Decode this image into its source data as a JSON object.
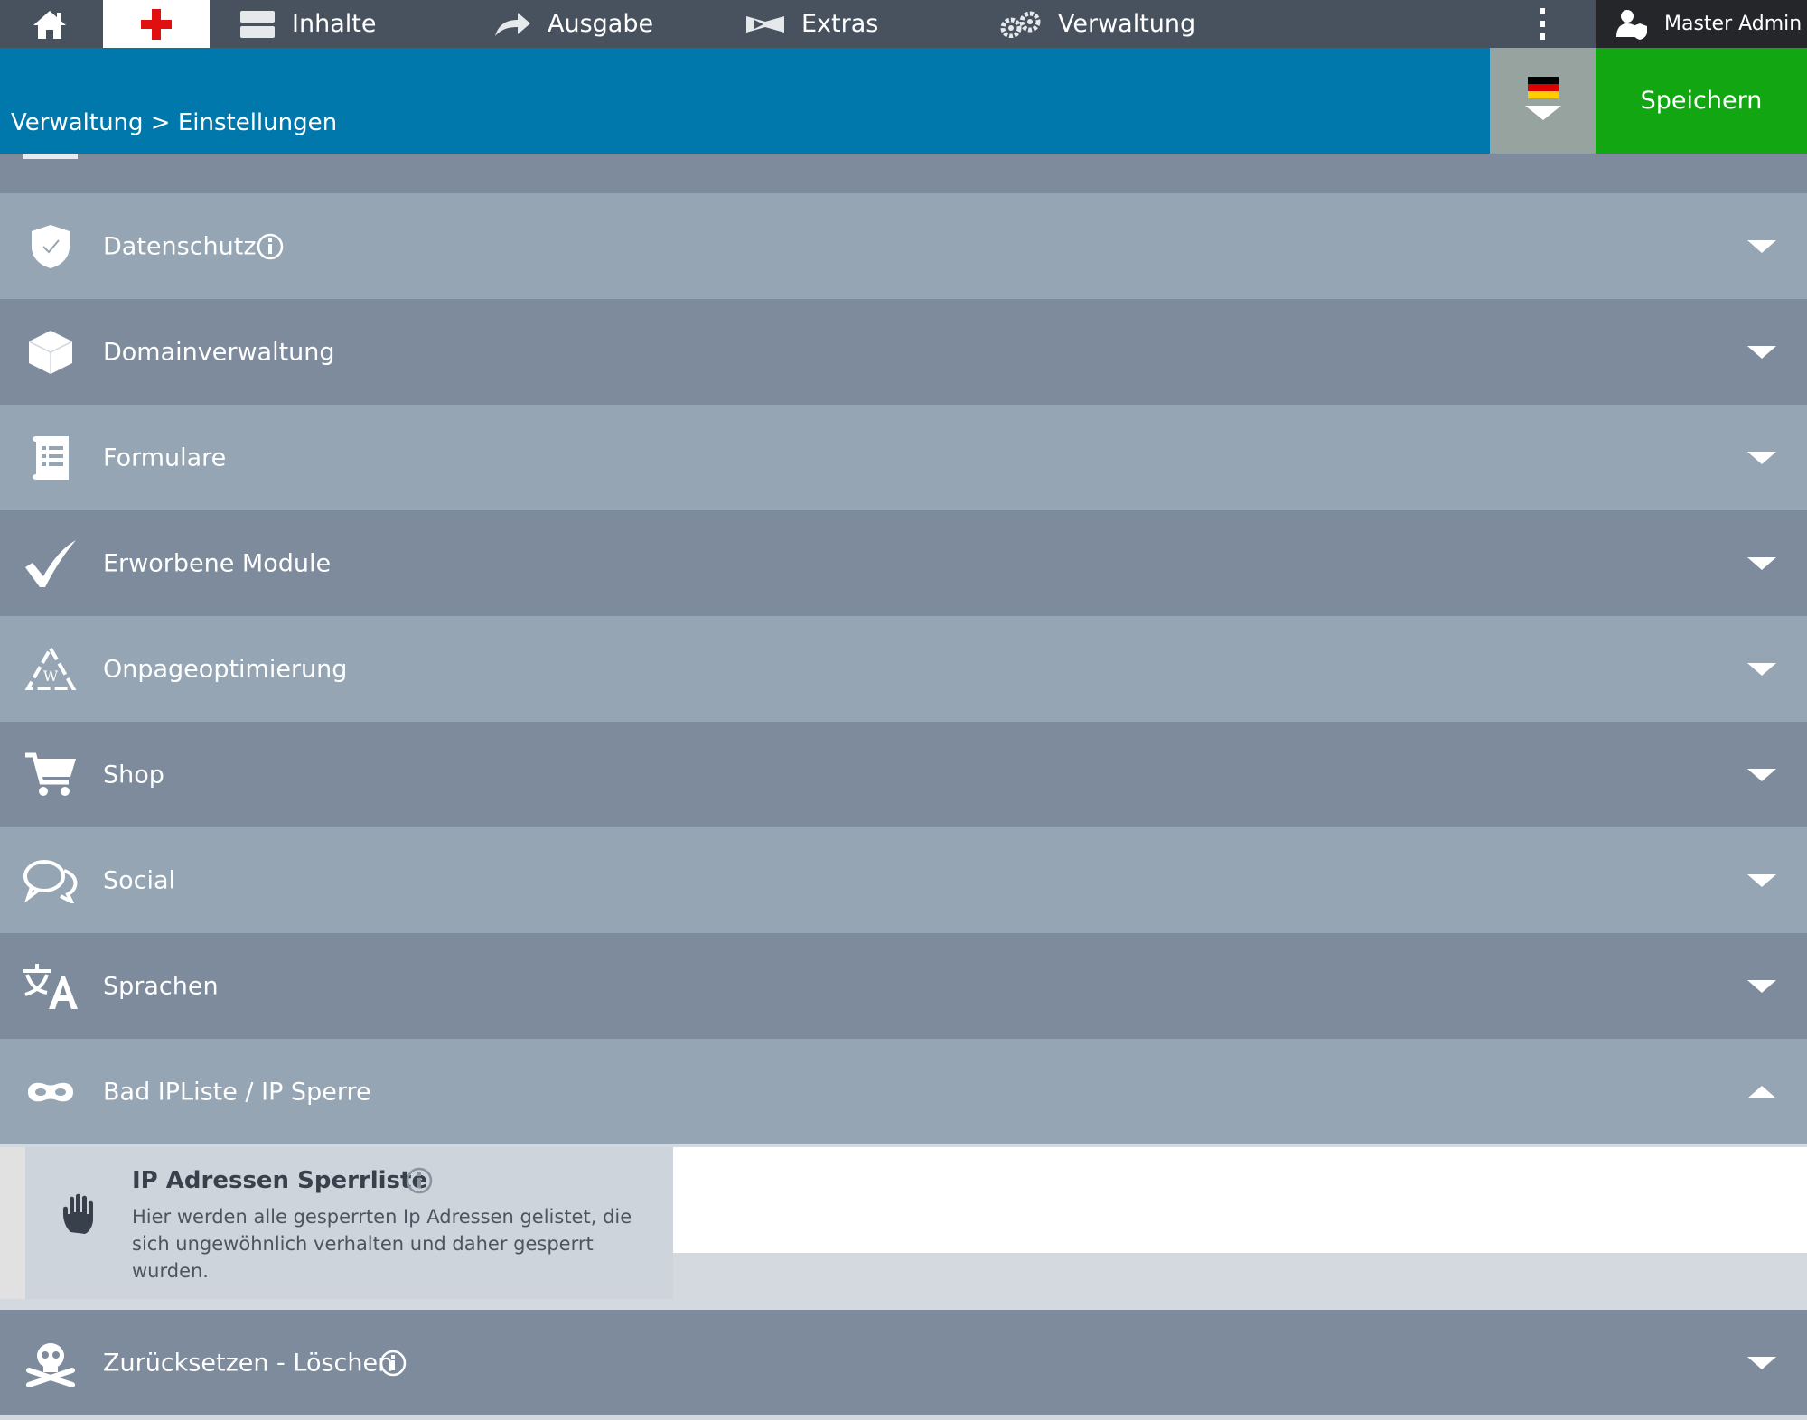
{
  "nav": {
    "items": [
      {
        "label": "Inhalte",
        "icon": "content-icon"
      },
      {
        "label": "Ausgabe",
        "icon": "arrow-right-icon"
      },
      {
        "label": "Extras",
        "icon": "extras-icon"
      },
      {
        "label": "Verwaltung",
        "icon": "gears-icon"
      }
    ],
    "user": "Master Admin"
  },
  "header": {
    "breadcrumb": "Verwaltung > Einstellungen",
    "save_label": "Speichern"
  },
  "sections": [
    {
      "label": "Datenschutz",
      "icon": "shield-check-icon",
      "info": true,
      "expanded": false
    },
    {
      "label": "Domainverwaltung",
      "icon": "cube-icon",
      "info": false,
      "expanded": false
    },
    {
      "label": "Formulare",
      "icon": "form-list-icon",
      "info": false,
      "expanded": false
    },
    {
      "label": "Erworbene Module",
      "icon": "checkmark-icon",
      "info": false,
      "expanded": false
    },
    {
      "label": "Onpageoptimierung",
      "icon": "recycle-icon",
      "info": false,
      "expanded": false
    },
    {
      "label": "Shop",
      "icon": "cart-icon",
      "info": false,
      "expanded": false
    },
    {
      "label": "Social",
      "icon": "chat-bubbles-icon",
      "info": false,
      "expanded": false
    },
    {
      "label": "Sprachen",
      "icon": "translate-icon",
      "info": false,
      "expanded": false
    },
    {
      "label": "Bad IPListe / IP Sperre",
      "icon": "mask-icon",
      "info": false,
      "expanded": true
    },
    {
      "label": "Zurücksetzen - Löschen",
      "icon": "skull-icon",
      "info": true,
      "expanded": false
    }
  ],
  "ip_panel": {
    "title": "IP Adressen Sperrliste",
    "description": "Hier werden alle gesperrten Ip Adressen gelistet, die sich ungewöhnlich verhalten und daher gesperrt wurden."
  },
  "colors": {
    "topbar": "#48525f",
    "header": "#0078ab",
    "save": "#13a613",
    "row_light": "#95a5b3",
    "row_dark": "#7d8b9c"
  }
}
